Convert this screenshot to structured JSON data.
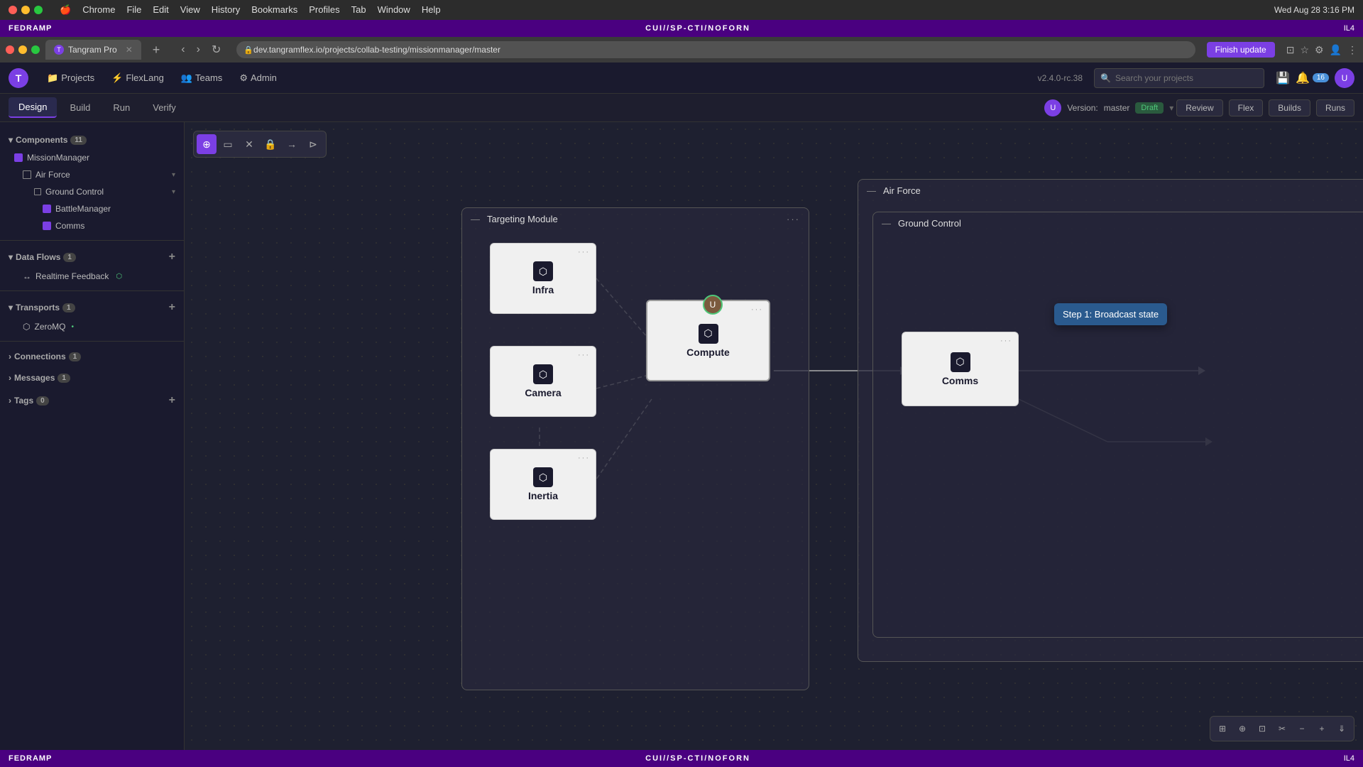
{
  "macbar": {
    "browser": "Chrome",
    "menu_items": [
      "Chrome",
      "File",
      "Edit",
      "View",
      "History",
      "Bookmarks",
      "Profiles",
      "Tab",
      "Window",
      "Help"
    ],
    "time": "Wed Aug 28  3:16 PM"
  },
  "fedramp": {
    "label": "FEDRAMP",
    "classification": "CUI//SP-CTI/NOFORN",
    "right_label": "IL4"
  },
  "browser": {
    "tab_title": "Tangram Pro",
    "address": "dev.tangramflex.io/projects/collab-testing/missionmanager/master",
    "finish_update": "Finish update"
  },
  "appheader": {
    "version": "v2.4.0-rc.38",
    "search_placeholder": "Search your projects",
    "nav": [
      {
        "label": "Projects",
        "icon": "📁"
      },
      {
        "label": "FlexLang",
        "icon": "⚡"
      },
      {
        "label": "Teams",
        "icon": "👥"
      },
      {
        "label": "Admin",
        "icon": "⚙"
      }
    ],
    "notifications": "16"
  },
  "toolbar": {
    "tabs": [
      {
        "label": "Design",
        "active": true
      },
      {
        "label": "Build",
        "active": false
      },
      {
        "label": "Run",
        "active": false
      },
      {
        "label": "Verify",
        "active": false
      }
    ],
    "version_label": "Version:",
    "version_name": "master",
    "draft_label": "Draft",
    "actions": [
      "Review",
      "Flex",
      "Builds",
      "Runs"
    ]
  },
  "sidebar": {
    "components_label": "Components",
    "components_count": "11",
    "data_flows_label": "Data Flows",
    "data_flows_count": "1",
    "transports_label": "Transports",
    "transports_count": "1",
    "connections_label": "Connections",
    "connections_count": "1",
    "messages_label": "Messages",
    "messages_count": "1",
    "tags_label": "Tags",
    "tags_count": "0",
    "mission_manager": "MissionManager",
    "air_force": "Air Force",
    "ground_control": "Ground Control",
    "battle_manager": "BattleManager",
    "comms": "Comms",
    "realtime_feedback": "Realtime Feedback",
    "zeromq": "ZeroMQ"
  },
  "canvas": {
    "targeting_module_label": "Targeting Module",
    "air_force_label": "Air Force",
    "ground_control_label": "Ground Control",
    "nodes": [
      {
        "id": "infra",
        "label": "Infra"
      },
      {
        "id": "compute",
        "label": "Compute"
      },
      {
        "id": "camera",
        "label": "Camera"
      },
      {
        "id": "inertia",
        "label": "Inertia"
      },
      {
        "id": "comms",
        "label": "Comms"
      }
    ],
    "step_tooltip": "Step 1: Broadcast state"
  },
  "statusbar": {
    "label": "FEDRAMP",
    "classification": "CUI//SP-CTI/NOFORN",
    "right": "IL4"
  }
}
